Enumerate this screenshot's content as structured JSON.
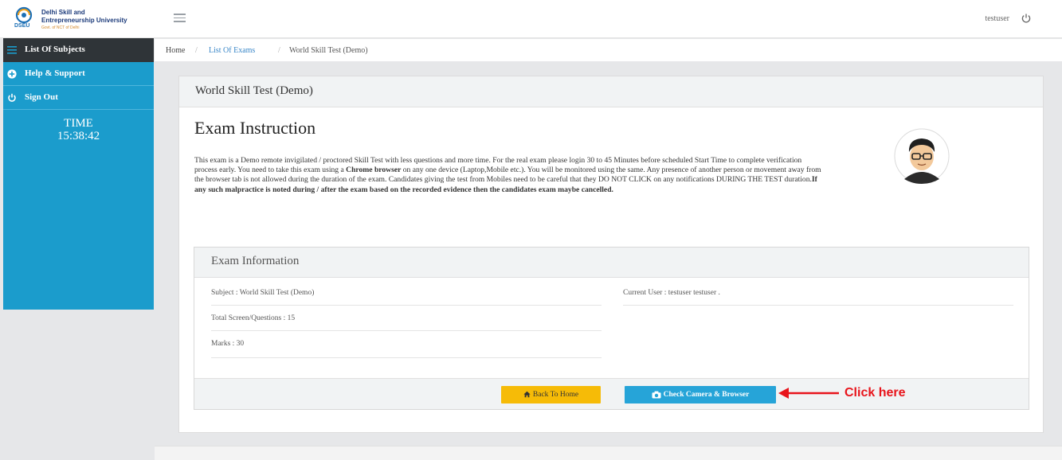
{
  "header": {
    "logo_line1": "Delhi Skill and",
    "logo_line2": "Entrepreneurship University",
    "logo_line3": "Govt. of NCT of Delhi",
    "logo_abbr": "DSEU",
    "user_name": "testuser"
  },
  "sidebar": {
    "items": [
      {
        "label": "List Of Subjects",
        "icon": "list-icon"
      },
      {
        "label": "Help & Support",
        "icon": "plus-circle-icon"
      },
      {
        "label": "Sign Out",
        "icon": "power-icon"
      }
    ],
    "time_label": "TIME",
    "time_value": "15:38:42"
  },
  "breadcrumb": {
    "home": "Home",
    "separator": "/",
    "list": "List Of Exams",
    "current": "World Skill Test (Demo)"
  },
  "card": {
    "title": "World Skill Test (Demo)",
    "heading": "Exam Instruction",
    "instruction_part1": "This exam is a Demo remote invigilated / proctored Skill Test with less questions and more time. For the real exam please login 30 to 45 Minutes before scheduled Start Time to complete verification process early. You need to take this exam using a ",
    "instruction_bold1": "Chrome browser",
    "instruction_part2": " on any one device (Laptop,Mobile etc.). You will be monitored using the same. Any presence of another person or movement away from the browser tab is not allowed during the duration of the exam. Candidates giving the test from Mobiles need to be careful that they DO NOT CLICK on any notifications DURING THE TEST duration.",
    "instruction_bold2": "If any such malpractice is noted during / after the exam based on the recorded evidence then the candidates exam maybe cancelled."
  },
  "info": {
    "title": "Exam Information",
    "subject": "Subject : World Skill Test (Demo)",
    "current_user": "Current User : testuser testuser .",
    "total_questions": "Total Screen/Questions : 15",
    "marks": "Marks : 30"
  },
  "buttons": {
    "back_home": "Back To Home",
    "check_camera": "Check Camera & Browser"
  },
  "annotation": {
    "click_here": "Click here",
    "color": "#e8141b"
  },
  "colors": {
    "sidebar": "#1b9ccc",
    "sidebar_active": "#2f3438",
    "primary_button": "#26a4d8",
    "warning_button": "#f6bb07"
  }
}
